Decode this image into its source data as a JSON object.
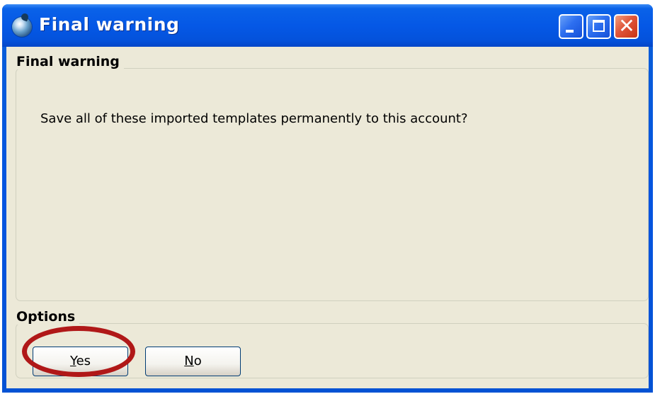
{
  "window": {
    "title": "Final warning",
    "title_color": "#ffffff",
    "titlebar_color": "#0558e6",
    "client_bg": "#ece9d8"
  },
  "titlebar_buttons": {
    "minimize_icon": "minimize-icon",
    "maximize_icon": "maximize-icon",
    "close_icon": "close-icon",
    "close_glyph": "✕"
  },
  "message_group": {
    "label": "Final warning",
    "text": "Save all of these imported templates permanently to this account?"
  },
  "options_group": {
    "label": "Options",
    "yes": {
      "mnemonic": "Y",
      "rest": "es"
    },
    "no": {
      "mnemonic": "N",
      "rest": "o"
    }
  },
  "annotation": {
    "highlight_color": "#b01818",
    "target": "yes-button"
  }
}
